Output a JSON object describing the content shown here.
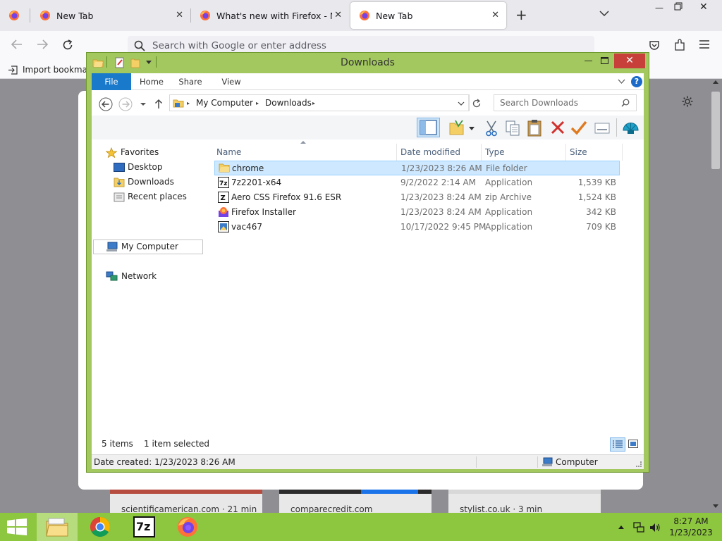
{
  "browser": {
    "tabs": [
      {
        "label": ""
      },
      {
        "label": "New Tab"
      },
      {
        "label": "What's new with Firefox - More"
      },
      {
        "label": "New Tab"
      }
    ],
    "url_placeholder": "Search with Google or enter address",
    "bookmark_item": "Import bookmarks...",
    "shortcuts": [
      {
        "label": "scientificamerican.com · 21 min"
      },
      {
        "label": "comparecredit.com"
      },
      {
        "label": "stylist.co.uk · 3 min"
      }
    ]
  },
  "explorer": {
    "title": "Downloads",
    "ribbon_tabs": [
      "File",
      "Home",
      "Share",
      "View"
    ],
    "breadcrumb": [
      "My Computer",
      "Downloads"
    ],
    "search_placeholder": "Search Downloads",
    "nav": {
      "favorites": "Favorites",
      "desktop": "Desktop",
      "downloads": "Downloads",
      "recent": "Recent places",
      "my_computer": "My Computer",
      "network": "Network"
    },
    "columns": [
      "Name",
      "Date modified",
      "Type",
      "Size"
    ],
    "files": [
      {
        "name": "chrome",
        "date": "1/23/2023 8:26 AM",
        "type": "File folder",
        "size": "",
        "icon": "folder-icon"
      },
      {
        "name": "7z2201-x64",
        "date": "9/2/2022 2:14 AM",
        "type": "Application",
        "size": "1,539 KB",
        "icon": "7zip-icon"
      },
      {
        "name": "Aero CSS Firefox 91.6 ESR",
        "date": "1/23/2023 8:24 AM",
        "type": "zip Archive",
        "size": "1,524 KB",
        "icon": "zip-icon"
      },
      {
        "name": "Firefox Installer",
        "date": "1/23/2023 8:24 AM",
        "type": "Application",
        "size": "342 KB",
        "icon": "firefox-installer-icon"
      },
      {
        "name": "vac467",
        "date": "10/17/2022 9:45 PM",
        "type": "Application",
        "size": "709 KB",
        "icon": "app-icon"
      }
    ],
    "status_items": "5 items",
    "status_selected": "1 item selected",
    "details_left": "Date created: 1/23/2023 8:26 AM",
    "details_right": "Computer"
  },
  "taskbar": {
    "time": "8:27 AM",
    "date": "1/23/2023",
    "sevenzip_label": "7z"
  },
  "colors": {
    "taskbar_green": "#8dc63f",
    "window_frame": "#a3c85f",
    "ribbon_file": "#1979ca",
    "selection": "#cde8ff",
    "close_button": "#c7403a"
  }
}
